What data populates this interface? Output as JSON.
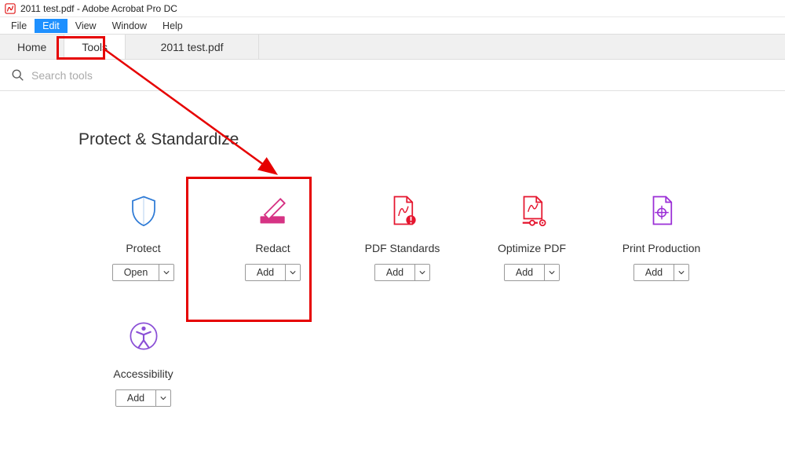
{
  "window": {
    "title": "2011 test.pdf - Adobe Acrobat Pro DC"
  },
  "menu": {
    "file": "File",
    "edit": "Edit",
    "view": "View",
    "window": "Window",
    "help": "Help"
  },
  "tabs": {
    "home": "Home",
    "tools": "Tools",
    "document": "2011 test.pdf"
  },
  "search": {
    "placeholder": "Search tools"
  },
  "section": {
    "title": "Protect & Standardize"
  },
  "tools": {
    "protect": {
      "label": "Protect",
      "button": "Open"
    },
    "redact": {
      "label": "Redact",
      "button": "Add"
    },
    "pdfstandards": {
      "label": "PDF Standards",
      "button": "Add"
    },
    "optimize": {
      "label": "Optimize PDF",
      "button": "Add"
    },
    "printprod": {
      "label": "Print Production",
      "button": "Add"
    },
    "accessibility": {
      "label": "Accessibility",
      "button": "Add"
    }
  }
}
